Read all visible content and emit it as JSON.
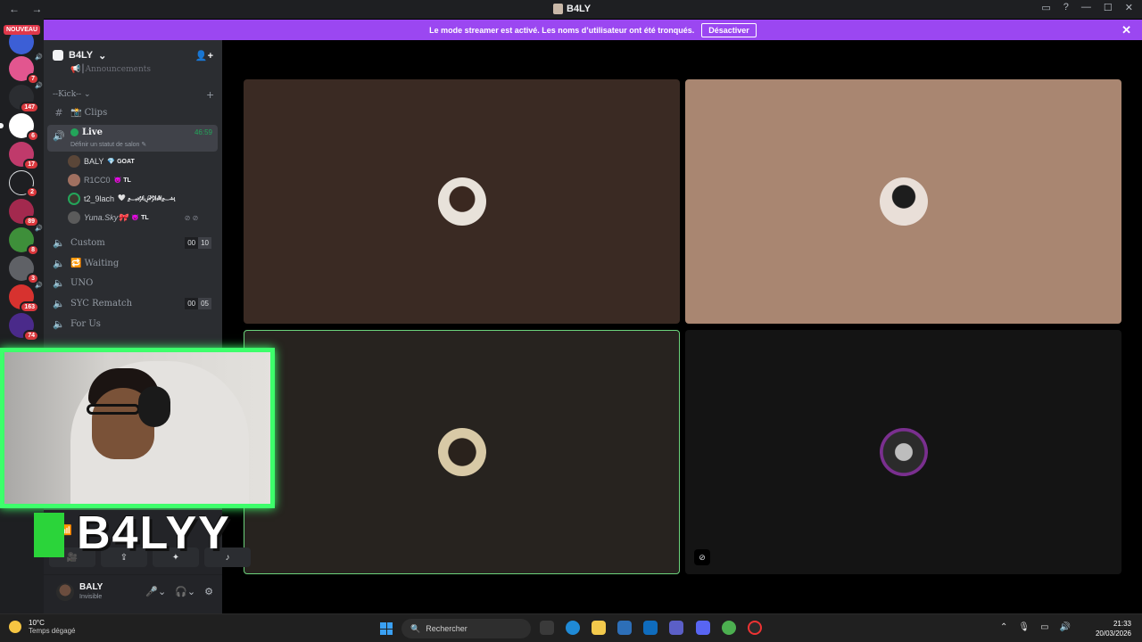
{
  "window": {
    "title": "B4LY",
    "nav_back": "←",
    "nav_forward": "→",
    "controls": [
      "—",
      "☐",
      "✕"
    ]
  },
  "banner": {
    "message": "Le mode streamer est activé. Les noms d’utilisateur ont été tronqués.",
    "button": "Désactiver",
    "badge_new": "NOUVEAU"
  },
  "rail": {
    "badges": [
      "7",
      "147",
      "6",
      "17",
      "2",
      "89",
      "8",
      "3",
      "163",
      "74"
    ]
  },
  "server": {
    "name": "B4LY",
    "clip_text": "📢┃Announcements",
    "category": "--Kick--",
    "channels": {
      "clips": "📸 Clips",
      "live_name": "Live",
      "live_time": "46:59",
      "live_status": "Définir un statut de salon ✎",
      "custom": "Custom",
      "custom_counts": [
        "00",
        "10"
      ],
      "waiting": "🔁 Waiting",
      "uno": "UNO",
      "syc": "SYC Rematch",
      "syc_counts": [
        "00",
        "05"
      ],
      "forus": "For Us"
    },
    "members": [
      {
        "name": "BALY",
        "tag": "GOAT",
        "tag_icon": "💎"
      },
      {
        "name": "R1CC0",
        "tag": "TL",
        "tag_icon": "😈"
      },
      {
        "name": "t2_9lach",
        "tag": "🤍 ﷽",
        "tag_icon": ""
      },
      {
        "name": "Yuna.Sky🎀",
        "tag": "TL",
        "tag_icon": "😈"
      }
    ]
  },
  "overlay": {
    "brand_text": "B4LYY"
  },
  "user": {
    "name": "BALY",
    "status": "Invisible"
  },
  "taskbar": {
    "temp": "10°C",
    "weather": "Temps dégagé",
    "search_placeholder": "Rechercher",
    "time": "21:33",
    "date": "20/03/2026"
  },
  "colors": {
    "accent_purple": "#9b47f1",
    "online_green": "#23a55a",
    "webcam_border": "#3dff6b"
  }
}
